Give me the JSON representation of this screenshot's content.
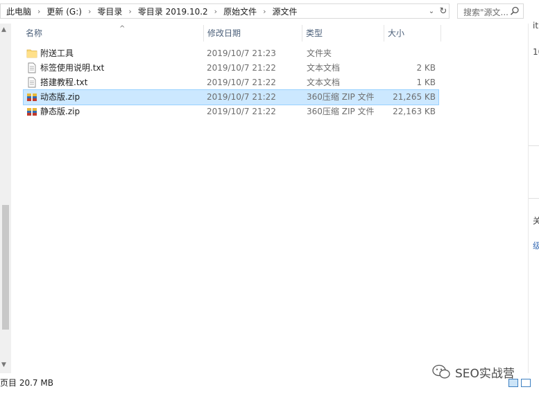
{
  "address": {
    "crumbs": [
      "此电脑",
      "更新 (G:)",
      "零目录",
      "零目录 2019.10.2",
      "原始文件",
      "源文件"
    ]
  },
  "search": {
    "placeholder": "搜索\"源文..."
  },
  "columns": {
    "name": "名称",
    "date": "修改日期",
    "type": "类型",
    "size": "大小"
  },
  "files": [
    {
      "name": "附送工具",
      "date": "2019/10/7 21:23",
      "type": "文件夹",
      "size": "",
      "icon": "folder-icon",
      "selected": false
    },
    {
      "name": "标签使用说明.txt",
      "date": "2019/10/7 21:22",
      "type": "文本文档",
      "size": "2 KB",
      "icon": "text-file-icon",
      "selected": false
    },
    {
      "name": "搭建教程.txt",
      "date": "2019/10/7 21:22",
      "type": "文本文档",
      "size": "1 KB",
      "icon": "text-file-icon",
      "selected": false
    },
    {
      "name": "动态版.zip",
      "date": "2019/10/7 21:22",
      "type": "360压缩 ZIP 文件",
      "size": "21,265 KB",
      "icon": "zip-archive-icon",
      "selected": true
    },
    {
      "name": "静态版.zip",
      "date": "2019/10/7 21:22",
      "type": "360压缩 ZIP 文件",
      "size": "22,163 KB",
      "icon": "zip-archive-icon",
      "selected": false
    }
  ],
  "status": {
    "text": "页目 20.7 MB"
  },
  "watermark": {
    "text": "SEO实战营"
  },
  "right_strip": [
    "it",
    "10",
    "关",
    "级"
  ],
  "colors": {
    "selection_bg": "#cce8ff",
    "selection_border": "#99d1ff",
    "header_text": "#4c607a"
  }
}
